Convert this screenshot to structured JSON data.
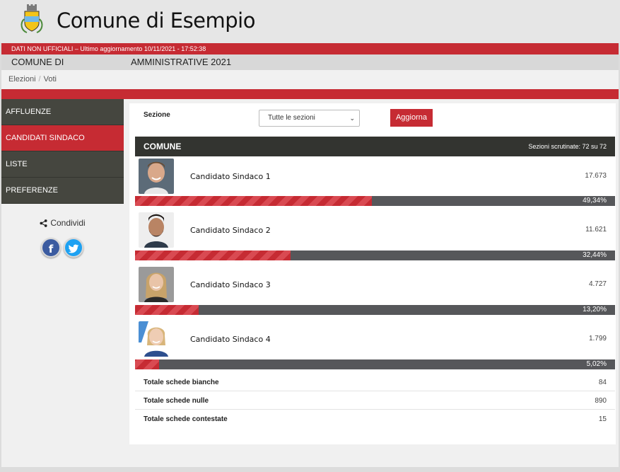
{
  "header": {
    "title": "Comune di Esempio",
    "crest_icon": "comune-crest"
  },
  "notice": "DATI NON UFFICIALI – Ultimo aggiornamento 10/11/2021 - 17:52:38",
  "comune_bar": {
    "left": "COMUNE DI",
    "right": "AMMINISTRATIVE 2021"
  },
  "breadcrumb": {
    "items": [
      "Elezioni",
      "Voti"
    ]
  },
  "sidebar": {
    "items": [
      {
        "label": "AFFLUENZE",
        "active": false
      },
      {
        "label": "CANDIDATI SINDACO",
        "active": true
      },
      {
        "label": "LISTE",
        "active": false
      },
      {
        "label": "PREFERENZE",
        "active": false
      }
    ]
  },
  "share": {
    "label": "Condividi",
    "facebook_glyph": "f",
    "twitter_glyph": "t"
  },
  "filter": {
    "label": "Sezione",
    "selected": "Tutte le sezioni",
    "button": "Aggiorna"
  },
  "results_header": {
    "title": "COMUNE",
    "scrutinate": "Sezioni scrutinate: 72 su 72"
  },
  "candidates": [
    {
      "name": "Candidato Sindaco  1",
      "votes": "17.673",
      "percent": "49,34%",
      "share": 0.4934
    },
    {
      "name": "Candidato Sindaco  2",
      "votes": "11.621",
      "percent": "32,44%",
      "share": 0.3244
    },
    {
      "name": "Candidato Sindaco  3",
      "votes": "4.727",
      "percent": "13,20%",
      "share": 0.132
    },
    {
      "name": "Candidato Sindaco  4",
      "votes": "1.799",
      "percent": "5,02%",
      "share": 0.0502
    }
  ],
  "totals": [
    {
      "label": "Totale schede bianche",
      "value": "84"
    },
    {
      "label": "Totale schede nulle",
      "value": "890"
    },
    {
      "label": "Totale schede contestate",
      "value": "15"
    }
  ],
  "colors": {
    "accent": "#c62b33",
    "dark": "#45463f",
    "bar_bg": "#56575a"
  }
}
